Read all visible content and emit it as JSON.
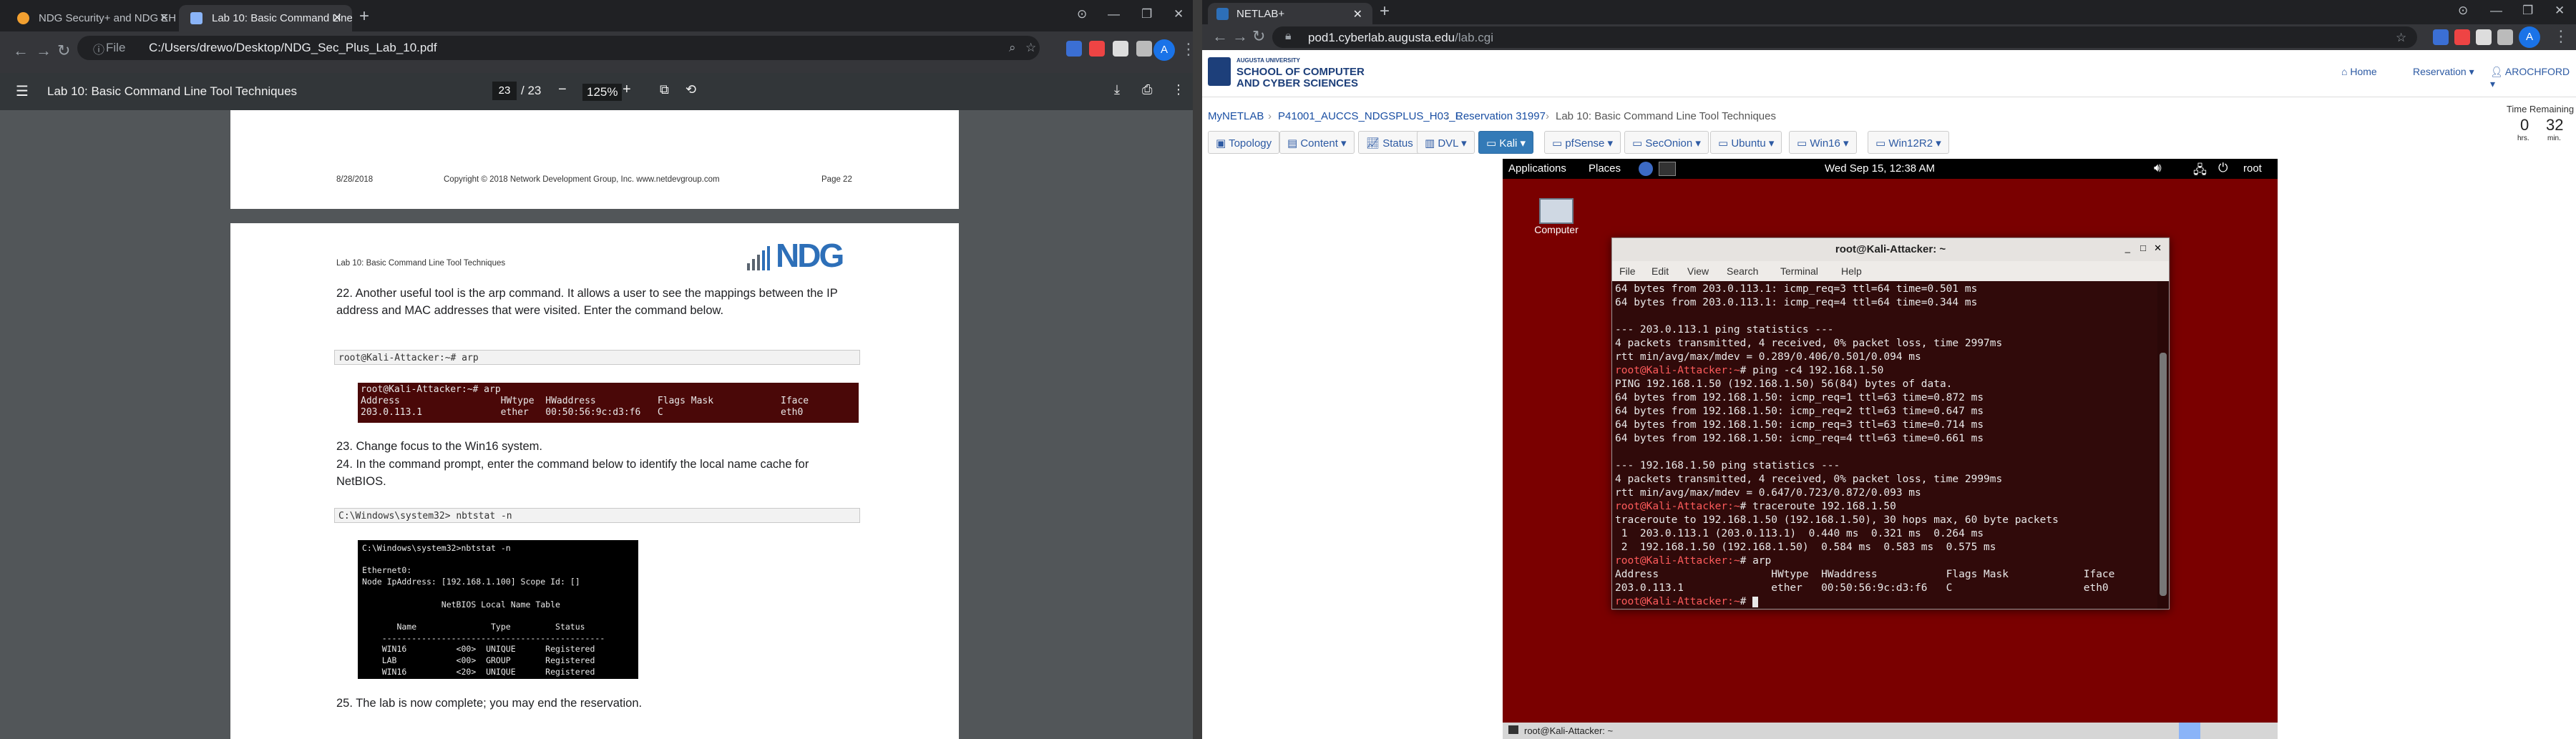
{
  "left": {
    "tabs": [
      {
        "label": "NDG Security+ and NDG EH Hu..."
      },
      {
        "label": "Lab 10: Basic Command Line To..."
      }
    ],
    "url_prefix": "File",
    "url": "C:/Users/drewo/Desktop/NDG_Sec_Plus_Lab_10.pdf",
    "pdf_title": "Lab 10: Basic Command Line Tool Techniques",
    "page_current": "23",
    "page_total": "/ 23",
    "zoom": "125%",
    "prev_footer": {
      "date": "8/28/2018",
      "copyright": "Copyright © 2018 Network Development Group, Inc.  www.netdevgroup.com",
      "page": "Page 22"
    },
    "page": {
      "header": "Lab 10:  Basic Command Line Tool Techniques",
      "logo": "NDG",
      "step22": "22. Another useful tool is the arp command. It allows a user to see the mappings between the IP address and MAC addresses that were visited. Enter the command below.",
      "cmd_arp": "root@Kali-Attacker:~# arp",
      "arp_output": "root@Kali-Attacker:~# arp\nAddress                  HWtype  HWaddress           Flags Mask            Iface\n203.0.113.1              ether   00:50:56:9c:d3:f6   C                     eth0",
      "step23": "23. Change focus to the Win16 system.",
      "step24": "24. In the command prompt, enter the command below to identify the local name cache for NetBIOS.",
      "cmd_nbt": "C:\\Windows\\system32> nbtstat -n",
      "nbt_output": "C:\\Windows\\system32>nbtstat -n\n\nEthernet0:\nNode IpAddress: [192.168.1.100] Scope Id: []\n\n                NetBIOS Local Name Table\n\n       Name               Type         Status\n    ---------------------------------------------\n    WIN16          <00>  UNIQUE      Registered\n    LAB            <00>  GROUP       Registered\n    WIN16          <20>  UNIQUE      Registered",
      "step25": "25. The lab is now complete; you may end the reservation."
    }
  },
  "right": {
    "tab": "NETLAB+",
    "url": "pod1.cyberlab.augusta.edu",
    "url_path": "/lab.cgi",
    "site": {
      "univ": "AUGUSTA UNIVERSITY",
      "school1": "SCHOOL OF COMPUTER",
      "school2": "AND CYBER SCIENCES"
    },
    "nav": {
      "home": "Home",
      "reservation": "Reservation",
      "user": "AROCHFORD"
    },
    "crumbs": [
      "MyNETLAB",
      "P41001_AUCCS_NDGSPLUS_H03_L",
      "Reservation 31997",
      "Lab 10: Basic Command Line Tool Techniques"
    ],
    "time": {
      "label": "Time Remaining",
      "hrs": "0",
      "hrs_lbl": "hrs.",
      "min": "32",
      "min_lbl": "min."
    },
    "menu": [
      "Topology",
      "Content",
      "Status",
      "DVL",
      "Kali",
      "pfSense",
      "SecOnion",
      "Ubuntu",
      "Win16",
      "Win12R2"
    ],
    "vm": {
      "apps": "Applications",
      "places": "Places",
      "clock": "Wed Sep 15, 12:38 AM",
      "user": "root",
      "desktop_icon": "Computer",
      "term_title": "root@Kali-Attacker: ~",
      "term_menu": [
        "File",
        "Edit",
        "View",
        "Search",
        "Terminal",
        "Help"
      ],
      "lines": [
        "64 bytes from 203.0.113.1: icmp_req=3 ttl=64 time=0.501 ms",
        "64 bytes from 203.0.113.1: icmp_req=4 ttl=64 time=0.344 ms",
        "",
        "--- 203.0.113.1 ping statistics ---",
        "4 packets transmitted, 4 received, 0% packet loss, time 2997ms",
        "rtt min/avg/max/mdev = 0.289/0.406/0.501/0.094 ms",
        "root@Kali-Attacker:~# ping -c4 192.168.1.50",
        "PING 192.168.1.50 (192.168.1.50) 56(84) bytes of data.",
        "64 bytes from 192.168.1.50: icmp_req=1 ttl=63 time=0.872 ms",
        "64 bytes from 192.168.1.50: icmp_req=2 ttl=63 time=0.647 ms",
        "64 bytes from 192.168.1.50: icmp_req=3 ttl=63 time=0.714 ms",
        "64 bytes from 192.168.1.50: icmp_req=4 ttl=63 time=0.661 ms",
        "",
        "--- 192.168.1.50 ping statistics ---",
        "4 packets transmitted, 4 received, 0% packet loss, time 2999ms",
        "rtt min/avg/max/mdev = 0.647/0.723/0.872/0.093 ms",
        "root@Kali-Attacker:~# traceroute 192.168.1.50",
        "traceroute to 192.168.1.50 (192.168.1.50), 30 hops max, 60 byte packets",
        " 1  203.0.113.1 (203.0.113.1)  0.440 ms  0.321 ms  0.264 ms",
        " 2  192.168.1.50 (192.168.1.50)  0.584 ms  0.583 ms  0.575 ms",
        "root@Kali-Attacker:~# arp",
        "Address                  HWtype  HWaddress           Flags Mask            Iface",
        "203.0.113.1              ether   00:50:56:9c:d3:f6   C                     eth0",
        "root@Kali-Attacker:~# "
      ],
      "taskbar": "root@Kali-Attacker: ~"
    }
  },
  "colors": {
    "accent": "#337ab7",
    "vm_bg": "#7a0000",
    "term_bg": "#300a0a",
    "prompt": "#ff5b5b"
  }
}
